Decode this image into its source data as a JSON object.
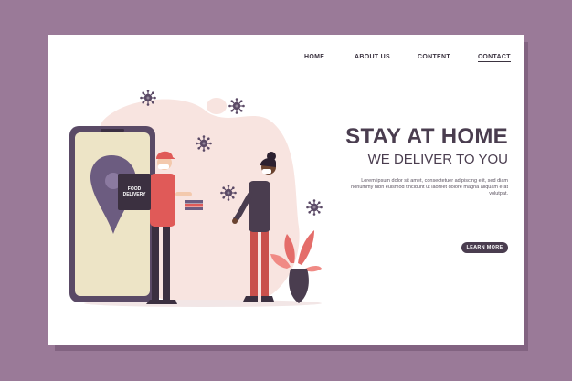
{
  "nav": {
    "home": "HOME",
    "about": "ABOUT US",
    "content": "CONTENT",
    "contact": "CONTACT"
  },
  "hero": {
    "headline": "STAY AT HOME",
    "subheadline": "WE DELIVER TO YOU",
    "body": "Lorem ipsum dolor sit amet, consectetuer adipiscing elit, sed diam nonummy nibh euismod tincidunt ut laoreet dolore magna aliquam erat volutpat.",
    "cta_label": "LEARN MORE"
  },
  "illustration": {
    "box_label_line1": "FOOD",
    "box_label_line2": "DELIVERY"
  },
  "colors": {
    "frame_background": "#9a7a98",
    "page_background": "#ffffff",
    "primary_dark": "#4a3d4f",
    "accent_red": "#e05a58",
    "blob_pink": "#f8e4e0"
  }
}
